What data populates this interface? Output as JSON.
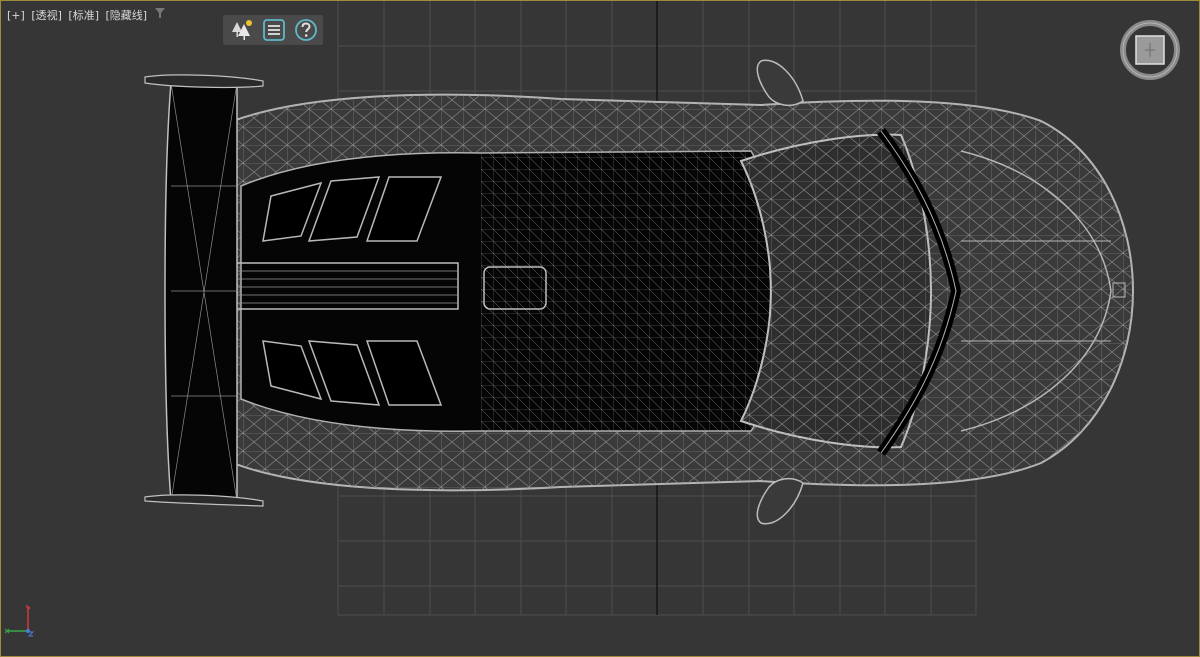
{
  "viewport": {
    "labels": {
      "plus": "[+]",
      "view": "[透视]",
      "shading_style": "[标准]",
      "render_mode": "[隐藏线]"
    },
    "toolbar": {
      "icons": [
        "trees-icon",
        "list-icon",
        "help-icon"
      ]
    },
    "colors": {
      "background": "#363636",
      "grid": "#4a4a4a",
      "grid_axis": "#111111",
      "wire": "#9a9a9a",
      "border": "#a08a3c",
      "toolbar": "#4a4a4a",
      "help_accent": "#5fb8c8"
    }
  }
}
